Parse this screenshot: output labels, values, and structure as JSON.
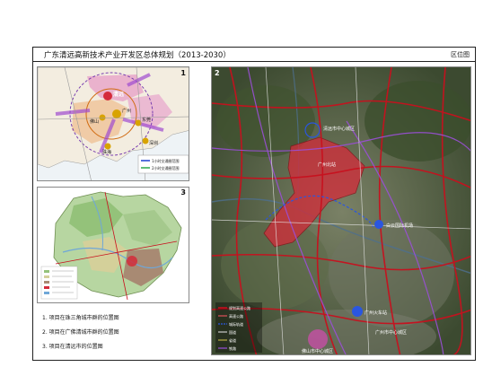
{
  "title": "广东清远高新技术产业开发区总体规划（2013-2030）",
  "tag": "区位图",
  "panels": {
    "p1": {
      "number": "1",
      "labels": {
        "qingyuan": "清远",
        "guangzhou": "广州",
        "foshan": "佛山",
        "dongguan": "东莞",
        "shenzhen": "深圳",
        "zhuhai": "珠海"
      },
      "legend": [
        "1小时交通圈范围",
        "2小时交通圈范围"
      ]
    },
    "p2": {
      "number": "2",
      "places": {
        "airport": "白云国际机场",
        "gz_station": "广州火车站",
        "gz_center": "广州市中心城区",
        "fs_center": "佛山市中心城区",
        "huadu": "广州北站",
        "qy_center": "清远市中心城区"
      },
      "legend": [
        "规划高速公路",
        "高速公路",
        "城际轨道",
        "国道",
        "省道",
        "铁路"
      ]
    },
    "p3": {
      "number": "3"
    }
  },
  "captions": [
    "1. 项目在珠三角城市群的位置图",
    "2. 项目在广佛清城市群的位置图",
    "3. 项目在清远市的位置图"
  ],
  "colors": {
    "highway": "#c8101e",
    "rail": "#7a3fb0",
    "site": "#d42b3a",
    "satellite": "#4a5a3c"
  }
}
